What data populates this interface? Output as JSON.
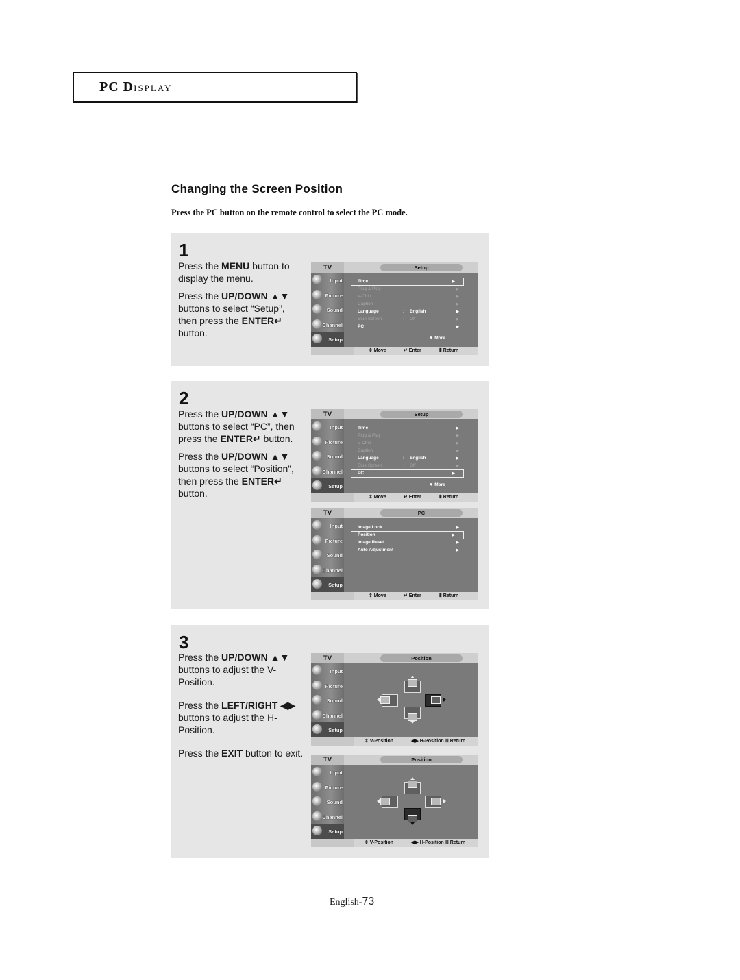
{
  "section": {
    "title_cap1": "PC D",
    "title_rest": "ISPLAY"
  },
  "heading": "Changing the Screen Position",
  "intro": "Press the PC button on the remote control to select the PC mode.",
  "steps": [
    {
      "number": "1",
      "paragraphs": [
        {
          "pre": "Press the ",
          "bold": "MENU",
          "post": " button to display the menu."
        },
        {
          "pre": "Press the ",
          "bold": "UP/DOWN ▲▼",
          "post": " buttons to select “Setup”, then press the ",
          "bold2": "ENTER↵",
          "post2": " button."
        }
      ]
    },
    {
      "number": "2",
      "paragraphs": [
        {
          "pre": "Press the ",
          "bold": "UP/DOWN ▲▼",
          "post": " buttons to select “PC”, then press the ",
          "bold2": "ENTER↵",
          "post2": " button."
        },
        {
          "pre": "Press the ",
          "bold": "UP/DOWN ▲▼",
          "post": " buttons to select “Position”, then press the ",
          "bold2": "ENTER↵",
          "post2": " button."
        }
      ]
    },
    {
      "number": "3",
      "paragraphs": [
        {
          "pre": "Press the ",
          "bold": "UP/DOWN ▲▼",
          "post": " buttons to adjust the V-Position."
        },
        {
          "pre": "Press the ",
          "bold": "LEFT/RIGHT ◀▶",
          "post": " buttons to adjust the H-Position."
        },
        {
          "pre": "Press the ",
          "bold": "EXIT",
          "post": " button to exit."
        }
      ]
    }
  ],
  "osd": {
    "tv_label": "TV",
    "sidebar": [
      "Input",
      "Picture",
      "Sound",
      "Channel",
      "Setup"
    ],
    "selected_sidebar": "Setup",
    "setup_title": "Setup",
    "setup_items": [
      {
        "label": "Time",
        "value": "",
        "enabled": true
      },
      {
        "label": "Plug & Play",
        "value": "",
        "enabled": false
      },
      {
        "label": "V-Chip",
        "value": "",
        "enabled": false
      },
      {
        "label": "Caption",
        "value": "",
        "enabled": false
      },
      {
        "label": "Language",
        "value": "English",
        "enabled": true
      },
      {
        "label": "Blue Screen",
        "value": "Off",
        "enabled": false
      },
      {
        "label": "PC",
        "value": "",
        "enabled": true
      }
    ],
    "more_label": "▼ More",
    "pc_title": "PC",
    "pc_items": [
      "Image Lock",
      "Position",
      "Image Reset",
      "Auto Adjustment"
    ],
    "position_title": "Position",
    "hints_menu": {
      "move": "⇕ Move",
      "enter": "↵ Enter",
      "return": "Ⅲ Return"
    },
    "hints_position": {
      "v": "⇕ V-Position",
      "h": "◀▶ H-Position",
      "return": "Ⅲ Return"
    },
    "screens": [
      {
        "id": "step1-setup",
        "selected_item": "Time"
      },
      {
        "id": "step2-setup",
        "selected_item": "PC"
      },
      {
        "id": "step2-pc",
        "selected_item": "Position"
      },
      {
        "id": "step3-position-h",
        "active_direction": "right"
      },
      {
        "id": "step3-position-v",
        "active_direction": "down"
      }
    ]
  },
  "footer": {
    "lang": "English-",
    "page": "73"
  }
}
